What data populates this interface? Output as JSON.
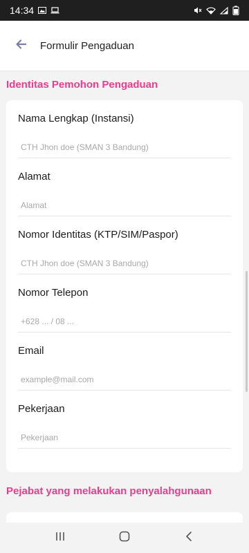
{
  "status_bar": {
    "time": "14:34",
    "icons": [
      "image-icon",
      "laptop-icon",
      "mute-icon",
      "wifi-icon",
      "signal-icon",
      "battery-icon"
    ]
  },
  "app_bar": {
    "title": "Formulir Pengaduan"
  },
  "sections": {
    "identity_title": "Identitas Pemohon Pengaduan",
    "official_title": "Pejabat yang melakukan penyalahgunaan"
  },
  "form": {
    "fields": [
      {
        "label": "Nama Lengkap (Instansi)",
        "placeholder": "CTH Jhon doe (SMAN 3 Bandung)",
        "value": ""
      },
      {
        "label": "Alamat",
        "placeholder": "Alamat",
        "value": ""
      },
      {
        "label": "Nomor Identitas (KTP/SIM/Paspor)",
        "placeholder": "CTH Jhon doe (SMAN 3 Bandung)",
        "value": ""
      },
      {
        "label": "Nomor Telepon",
        "placeholder": "+628 ... / 08 ...",
        "value": ""
      },
      {
        "label": "Email",
        "placeholder": "example@mail.com",
        "value": ""
      },
      {
        "label": "Pekerjaan",
        "placeholder": "Pekerjaan",
        "value": ""
      }
    ]
  },
  "colors": {
    "accent": "#e83e8c",
    "status_bar_bg": "#1f1f1f",
    "background": "#f3f3f3",
    "card_bg": "#ffffff",
    "back_arrow": "#7b7fa3"
  }
}
